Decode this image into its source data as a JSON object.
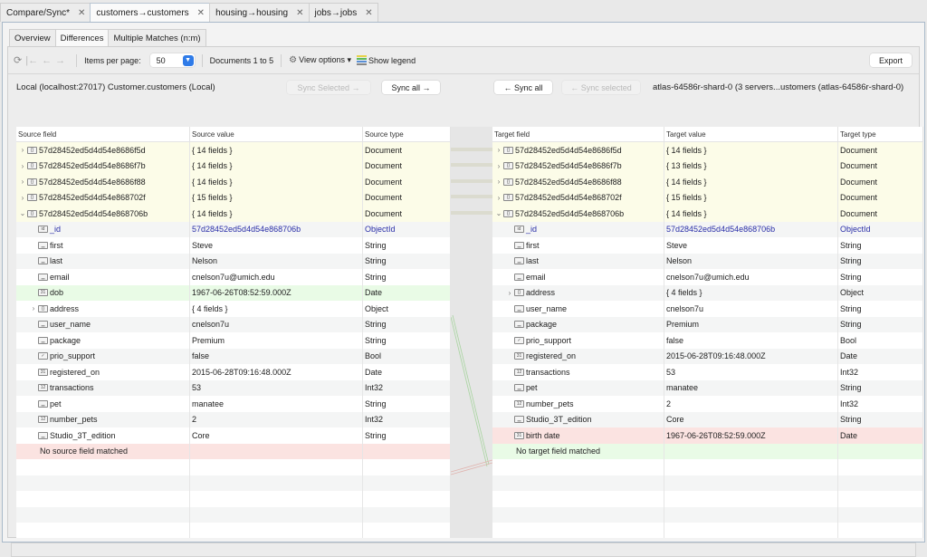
{
  "outer_tabs": [
    {
      "label": "Compare/Sync*",
      "active": false
    },
    {
      "label": "customers→customers",
      "active": true
    },
    {
      "label": "housing→housing",
      "active": false
    },
    {
      "label": "jobs→jobs",
      "active": false
    }
  ],
  "inner_tabs": [
    {
      "label": "Overview",
      "active": false
    },
    {
      "label": "Differences",
      "active": true
    },
    {
      "label": "Multiple Matches (n:m)",
      "active": false
    }
  ],
  "toolbar": {
    "refresh_icon": "refresh-icon",
    "items_per_page_label": "Items per page:",
    "items_per_page_value": "50",
    "documents_range": "Documents 1 to 5",
    "view_options_label": "View options ▾",
    "show_legend_label": "Show legend",
    "export_label": "Export"
  },
  "source": {
    "connection": "Local (localhost:27017) Customer.customers (Local)",
    "sync_selected_label": "Sync Selected →",
    "sync_all_label": "Sync all →",
    "headers": [
      "Source field",
      "Source value",
      "Source type"
    ],
    "rows": [
      {
        "kind": "doc",
        "chev": ">",
        "icon": "{}",
        "field": "57d28452ed5d4d54e8686f5d",
        "value": "{ 14 fields }",
        "type": "Document"
      },
      {
        "kind": "doc",
        "chev": ">",
        "icon": "{}",
        "field": "57d28452ed5d4d54e8686f7b",
        "value": "{ 14 fields }",
        "type": "Document"
      },
      {
        "kind": "doc",
        "chev": ">",
        "icon": "{}",
        "field": "57d28452ed5d4d54e8686f88",
        "value": "{ 14 fields }",
        "type": "Document"
      },
      {
        "kind": "doc",
        "chev": ">",
        "icon": "{}",
        "field": "57d28452ed5d4d54e868702f",
        "value": "{ 15 fields }",
        "type": "Document"
      },
      {
        "kind": "doc",
        "chev": "v",
        "icon": "{}",
        "field": "57d28452ed5d4d54e868706b",
        "value": "{ 14 fields }",
        "type": "Document"
      },
      {
        "kind": "id",
        "chev": "",
        "icon": "id",
        "field": "_id",
        "value": "57d28452ed5d4d54e868706b",
        "type": "ObjectId"
      },
      {
        "kind": "",
        "chev": "",
        "icon": "str",
        "field": "first",
        "value": "Steve",
        "type": "String"
      },
      {
        "kind": "",
        "chev": "",
        "icon": "str",
        "field": "last",
        "value": "Nelson",
        "type": "String"
      },
      {
        "kind": "",
        "chev": "",
        "icon": "str",
        "field": "email",
        "value": "cnelson7u@umich.edu",
        "type": "String"
      },
      {
        "kind": "green",
        "chev": "",
        "icon": "date",
        "field": "dob",
        "value": "1967-06-26T08:52:59.000Z",
        "type": "Date"
      },
      {
        "kind": "",
        "chev": ">",
        "icon": "{}",
        "field": "address",
        "value": "{ 4 fields }",
        "type": "Object"
      },
      {
        "kind": "",
        "chev": "",
        "icon": "str",
        "field": "user_name",
        "value": "cnelson7u",
        "type": "String"
      },
      {
        "kind": "",
        "chev": "",
        "icon": "str",
        "field": "package",
        "value": "Premium",
        "type": "String"
      },
      {
        "kind": "",
        "chev": "",
        "icon": "bool",
        "field": "prio_support",
        "value": "false",
        "type": "Bool"
      },
      {
        "kind": "",
        "chev": "",
        "icon": "date",
        "field": "registered_on",
        "value": "2015-06-28T09:16:48.000Z",
        "type": "Date"
      },
      {
        "kind": "",
        "chev": "",
        "icon": "int",
        "field": "transactions",
        "value": "53",
        "type": "Int32"
      },
      {
        "kind": "",
        "chev": "",
        "icon": "str",
        "field": "pet",
        "value": "manatee",
        "type": "String"
      },
      {
        "kind": "",
        "chev": "",
        "icon": "int",
        "field": "number_pets",
        "value": "2",
        "type": "Int32"
      },
      {
        "kind": "",
        "chev": "",
        "icon": "str",
        "field": "Studio_3T_edition",
        "value": "Core",
        "type": "String"
      },
      {
        "kind": "red",
        "chev": "",
        "icon": "",
        "field": "No source field matched",
        "value": "",
        "type": ""
      }
    ]
  },
  "target": {
    "connection": "atlas-64586r-shard-0 (3 servers...ustomers (atlas-64586r-shard-0)",
    "sync_all_label": "← Sync all",
    "sync_selected_label": "← Sync selected",
    "headers": [
      "Target field",
      "Target value",
      "Target type"
    ],
    "rows": [
      {
        "kind": "doc",
        "chev": ">",
        "icon": "{}",
        "field": "57d28452ed5d4d54e8686f5d",
        "value": "{ 14 fields }",
        "type": "Document"
      },
      {
        "kind": "doc",
        "chev": ">",
        "icon": "{}",
        "field": "57d28452ed5d4d54e8686f7b",
        "value": "{ 13 fields }",
        "type": "Document"
      },
      {
        "kind": "doc",
        "chev": ">",
        "icon": "{}",
        "field": "57d28452ed5d4d54e8686f88",
        "value": "{ 14 fields }",
        "type": "Document"
      },
      {
        "kind": "doc",
        "chev": ">",
        "icon": "{}",
        "field": "57d28452ed5d4d54e868702f",
        "value": "{ 15 fields }",
        "type": "Document"
      },
      {
        "kind": "doc",
        "chev": "v",
        "icon": "{}",
        "field": "57d28452ed5d4d54e868706b",
        "value": "{ 14 fields }",
        "type": "Document"
      },
      {
        "kind": "id",
        "chev": "",
        "icon": "id",
        "field": "_id",
        "value": "57d28452ed5d4d54e868706b",
        "type": "ObjectId"
      },
      {
        "kind": "",
        "chev": "",
        "icon": "str",
        "field": "first",
        "value": "Steve",
        "type": "String"
      },
      {
        "kind": "",
        "chev": "",
        "icon": "str",
        "field": "last",
        "value": "Nelson",
        "type": "String"
      },
      {
        "kind": "",
        "chev": "",
        "icon": "str",
        "field": "email",
        "value": "cnelson7u@umich.edu",
        "type": "String"
      },
      {
        "kind": "",
        "chev": ">",
        "icon": "{}",
        "field": "address",
        "value": "{ 4 fields }",
        "type": "Object"
      },
      {
        "kind": "",
        "chev": "",
        "icon": "str",
        "field": "user_name",
        "value": "cnelson7u",
        "type": "String"
      },
      {
        "kind": "",
        "chev": "",
        "icon": "str",
        "field": "package",
        "value": "Premium",
        "type": "String"
      },
      {
        "kind": "",
        "chev": "",
        "icon": "bool",
        "field": "prio_support",
        "value": "false",
        "type": "Bool"
      },
      {
        "kind": "",
        "chev": "",
        "icon": "date",
        "field": "registered_on",
        "value": "2015-06-28T09:16:48.000Z",
        "type": "Date"
      },
      {
        "kind": "",
        "chev": "",
        "icon": "int",
        "field": "transactions",
        "value": "53",
        "type": "Int32"
      },
      {
        "kind": "",
        "chev": "",
        "icon": "str",
        "field": "pet",
        "value": "manatee",
        "type": "String"
      },
      {
        "kind": "",
        "chev": "",
        "icon": "int",
        "field": "number_pets",
        "value": "2",
        "type": "Int32"
      },
      {
        "kind": "",
        "chev": "",
        "icon": "str",
        "field": "Studio_3T_edition",
        "value": "Core",
        "type": "String"
      },
      {
        "kind": "red",
        "chev": "",
        "icon": "date",
        "field": "birth date",
        "value": "1967-06-26T08:52:59.000Z",
        "type": "Date"
      },
      {
        "kind": "green",
        "chev": "",
        "icon": "",
        "field": "No target field matched",
        "value": "",
        "type": ""
      }
    ]
  },
  "colors": {
    "doc_row": "#fcfce8",
    "added_row": "#e9fbe6",
    "removed_row": "#fbe3e1",
    "objectid_text": "#2a2fa8",
    "select_accent": "#2f7be8"
  }
}
